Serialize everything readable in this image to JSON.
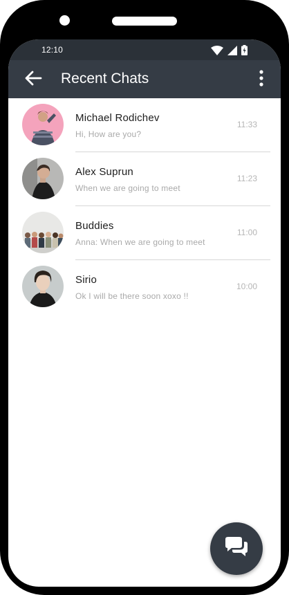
{
  "status_bar": {
    "time": "12:10",
    "icons": [
      "wifi-icon",
      "signal-icon",
      "battery-charging-icon"
    ]
  },
  "app_bar": {
    "title": "Recent Chats",
    "back_icon": "arrow-left-icon",
    "menu_icon": "more-vertical-icon"
  },
  "chats": [
    {
      "name": "Michael Rodichev",
      "message": "Hi, How are you?",
      "time": "11:33"
    },
    {
      "name": "Alex Suprun",
      "message": "When we are going to meet",
      "time": "11:23"
    },
    {
      "name": "Buddies",
      "message": "Anna: When we are going to meet",
      "time": "11:00"
    },
    {
      "name": "Sirio",
      "message": "Ok I will be there soon xoxo !!",
      "time": "10:00"
    }
  ],
  "fab": {
    "icon": "chat-bubbles-icon"
  },
  "colors": {
    "app_bar": "#353c45",
    "status_bar": "#2b3138",
    "fab": "#353c45",
    "name_text": "#1c1c1c",
    "secondary_text": "#a9a9a9"
  }
}
